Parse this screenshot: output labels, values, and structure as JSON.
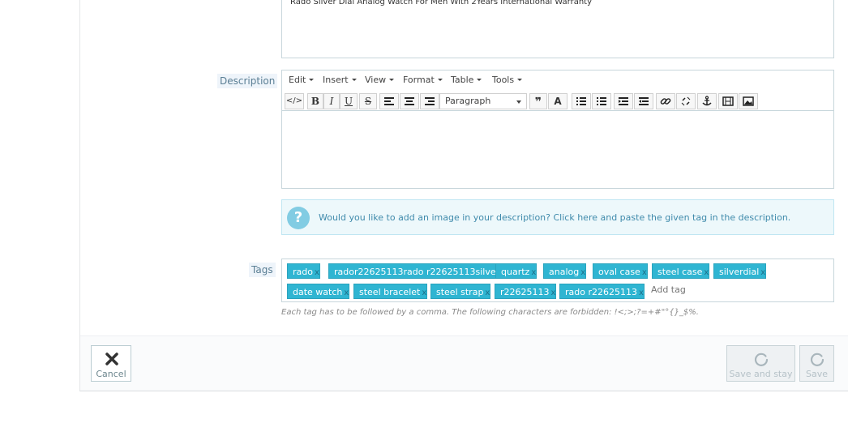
{
  "short_description": {
    "text": "Rado Silver Dial Analog Watch For Men With 2Years International Warranty"
  },
  "description": {
    "label": "Description",
    "menu": [
      "Edit",
      "Insert",
      "View",
      "Format",
      "Table",
      "Tools"
    ],
    "format_select": "Paragraph",
    "toolbar": {
      "source_code": "</>",
      "bold": "B",
      "italic": "I",
      "underline": "U",
      "strikethrough": "S",
      "blockquote": "❞",
      "text_color": "A"
    }
  },
  "info": {
    "icon": "?",
    "message": "Would you like to add an image in your description? Click here and paste the given tag in the description."
  },
  "tags": {
    "label": "Tags",
    "items": [
      "rado",
      "rador22625113rado r22625113silve",
      "quartz",
      "analog",
      "oval case",
      "steel case",
      "silverdial",
      "date watch",
      "steel bracelet",
      "steel strap",
      "r22625113",
      "rado r22625113"
    ],
    "remove_glyph": "x",
    "placeholder": "Add tag",
    "hint": "Each tag has to be followed by a comma. The following characters are forbidden: !<;>;?=+#\"°{}_$%."
  },
  "footer": {
    "cancel": "Cancel",
    "save_and_stay": "Save and stay",
    "save": "Save"
  },
  "colors": {
    "accent": "#2fb5d2",
    "label_bg": "#eef4fa",
    "info_bg": "#edf8fb"
  }
}
